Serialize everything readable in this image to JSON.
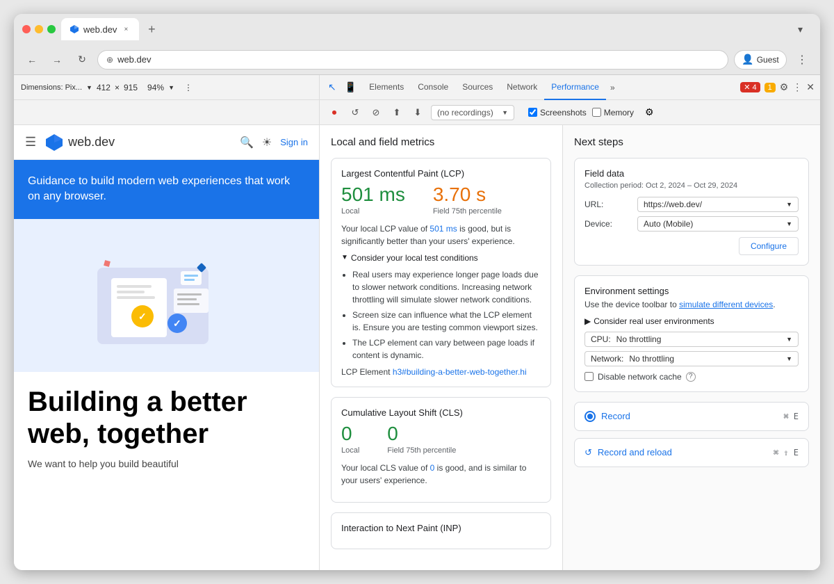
{
  "browser": {
    "tab_title": "web.dev",
    "tab_close": "×",
    "tab_new": "+",
    "url": "web.dev",
    "nav_back": "←",
    "nav_forward": "→",
    "nav_refresh": "↻",
    "profile_label": "Guest",
    "more_label": "⋮"
  },
  "devtools_bar": {
    "dimensions_label": "Dimensions: Pix...",
    "width": "412",
    "x": "×",
    "height": "915",
    "zoom": "94%",
    "icons": {
      "pointer": "⊹",
      "device": "▱",
      "elements": "Elements",
      "console": "Console",
      "sources": "Sources",
      "network": "Network",
      "performance": "Performance",
      "more": "»"
    },
    "errors": "4",
    "warnings": "1",
    "gear": "⚙",
    "kebab": "⋮",
    "close": "×"
  },
  "recording_bar": {
    "record_icon": "⏺",
    "reload_icon": "↺",
    "stop_icon": "⏹",
    "no_recordings": "(no recordings)",
    "screenshots_label": "Screenshots",
    "memory_label": "Memory",
    "gear": "⚙"
  },
  "website": {
    "menu_icon": "☰",
    "logo_text": "web.dev",
    "search_icon": "🔍",
    "sun_icon": "☀",
    "signin_label": "Sign in",
    "hero_text": "Guidance to build modern web experiences that work on any browser.",
    "main_heading": "Building a better web, together",
    "sub_text": "We want to help you build beautiful"
  },
  "performance": {
    "panel_title": "Local and field metrics",
    "lcp_card": {
      "title": "Largest Contentful Paint (LCP)",
      "local_value": "501 ms",
      "local_label": "Local",
      "field_value": "3.70 s",
      "field_label": "Field 75th percentile",
      "description": "Your local LCP value of 501 ms is good, but is significantly better than your users' experience.",
      "expand_label": "Consider your local test conditions",
      "bullets": [
        "Real users may experience longer page loads due to slower network conditions. Increasing network throttling will simulate slower network conditions.",
        "Screen size can influence what the LCP element is. Ensure you are testing common viewport sizes.",
        "The LCP element can vary between page loads if content is dynamic."
      ],
      "lcp_element_label": "LCP Element",
      "lcp_element_value": "h3#building-a-better-web-together.hi"
    },
    "cls_card": {
      "title": "Cumulative Layout Shift (CLS)",
      "local_value": "0",
      "local_label": "Local",
      "field_value": "0",
      "field_label": "Field 75th percentile",
      "description": "Your local CLS value of 0 is good, and is similar to your users' experience."
    },
    "inp_card": {
      "title": "Interaction to Next Paint (INP)"
    }
  },
  "next_steps": {
    "title": "Next steps",
    "field_data_card": {
      "title": "Field data",
      "subtitle": "Collection period: Oct 2, 2024 – Oct 29, 2024",
      "url_label": "URL:",
      "url_value": "https://web.dev/",
      "device_label": "Device:",
      "device_value": "Auto (Mobile)",
      "configure_label": "Configure"
    },
    "environment_card": {
      "title": "Environment settings",
      "description": "Use the device toolbar to",
      "link_text": "simulate different devices",
      "link_suffix": ".",
      "expand_label": "Consider real user environments",
      "cpu_label": "CPU:",
      "cpu_value": "No throttling",
      "network_label": "Network:",
      "network_value": "No throttling",
      "cache_label": "Disable network cache",
      "cache_question": "?"
    },
    "record_card": {
      "label": "Record",
      "shortcut": "⌘ E"
    },
    "record_reload_card": {
      "label": "Record and reload",
      "shortcut": "⌘ ⇧ E"
    }
  }
}
